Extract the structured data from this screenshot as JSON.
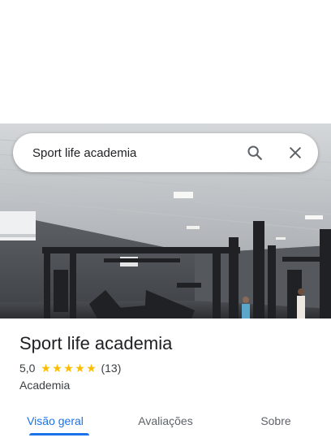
{
  "search": {
    "query": "Sport life academia"
  },
  "place": {
    "name": "Sport life academia",
    "rating": "5,0",
    "review_count": "(13)",
    "stars": 5,
    "category": "Academia"
  },
  "tabs": [
    {
      "label": "Visão geral",
      "active": true
    },
    {
      "label": "Avaliações",
      "active": false
    },
    {
      "label": "Sobre",
      "active": false
    }
  ],
  "colors": {
    "accent": "#1a73e8",
    "star": "#fbbc04",
    "text_primary": "#202124",
    "text_secondary": "#3c4043"
  },
  "icons": {
    "search": "search-icon",
    "close": "close-icon",
    "star": "star-icon"
  }
}
